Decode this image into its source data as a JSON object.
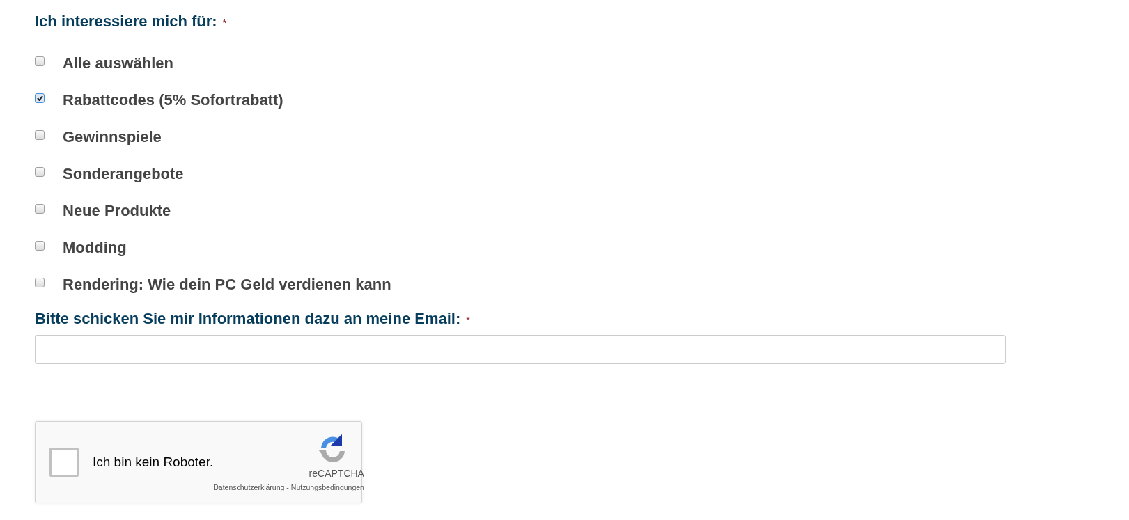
{
  "interests": {
    "label": "Ich interessiere mich für:",
    "required_mark": "*",
    "options": [
      {
        "label": "Alle auswählen",
        "checked": false
      },
      {
        "label": "Rabattcodes (5% Sofortrabatt)",
        "checked": true
      },
      {
        "label": "Gewinnspiele",
        "checked": false
      },
      {
        "label": "Sonderangebote",
        "checked": false
      },
      {
        "label": "Neue Produkte",
        "checked": false
      },
      {
        "label": "Modding",
        "checked": false
      },
      {
        "label": "Rendering: Wie dein PC Geld verdienen kann",
        "checked": false
      }
    ]
  },
  "email": {
    "label": "Bitte schicken Sie mir Informationen dazu an meine Email:",
    "required_mark": "*"
  },
  "captcha": {
    "label": "Ich bin kein Roboter.",
    "checked": false,
    "brand": "reCAPTCHA",
    "privacy": "Datenschutzerklärung",
    "separator": "-",
    "terms": "Nutzungsbedingungen"
  }
}
